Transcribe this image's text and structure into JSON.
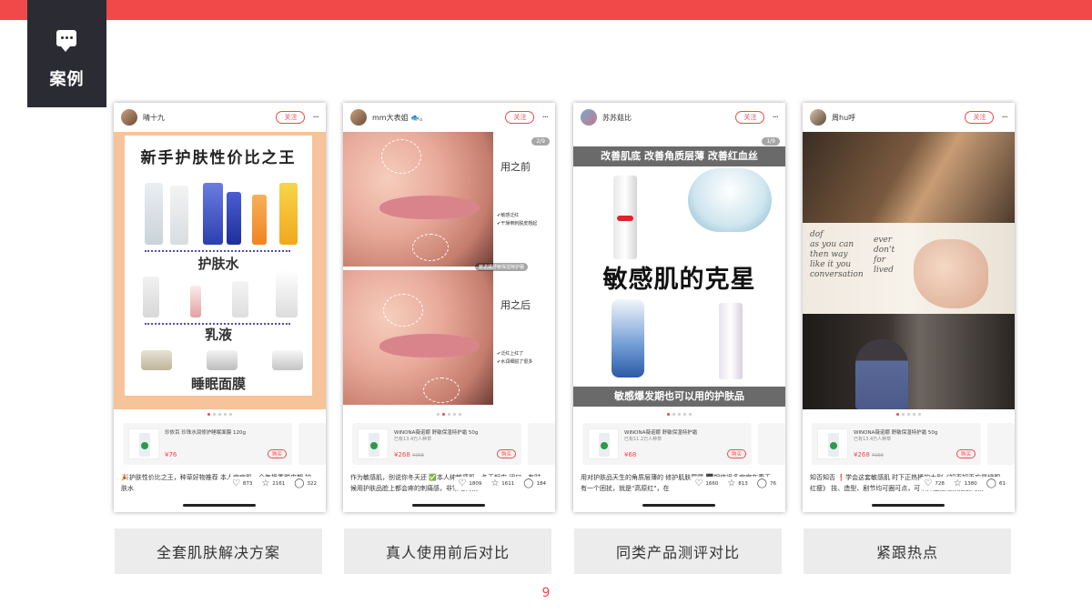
{
  "header": {
    "badge_label": "案例",
    "chat_icon": "chat-bubble-icon",
    "accent": "#f1484a",
    "badge_bg": "#2b2b33"
  },
  "page_number": "9",
  "cards": [
    {
      "user": "晴十九",
      "follow": "关注",
      "more": "···",
      "art": {
        "title": "新手护肤性价比之王",
        "sections": [
          "护肤水",
          "乳液",
          "睡眠面膜"
        ]
      },
      "product": {
        "name": "珍依百 珍珠水润修护睡眠面膜 120g",
        "sub": "",
        "price": "¥76",
        "buy": "购买"
      },
      "caption": "🎉护肤性价比之王，种草好物推荐 本人痘痘肌，全年换季脱皮期 护肤水",
      "likes": "873",
      "stars": "2161",
      "comments": "322",
      "label": "全套肌肤解决方案"
    },
    {
      "user": "mm大表姐 🐟。",
      "follow": "关注",
      "more": "···",
      "art": {
        "page": "2/9",
        "before": "用之前",
        "after": "用之后",
        "before_notes": [
          "✔敏感泛红",
          "✔干燥倒刺脱皮翘起"
        ],
        "after_notes": [
          "✔泛红上红了",
          "✔水润细腻了很多"
        ],
        "tag": "薇诺娜舒敏保湿特护霜"
      },
      "product": {
        "name": "WINONA薇诺娜 舒敏保湿特护霜 50g",
        "sub": "已有13.4万人种草",
        "price": "¥268",
        "orig": "¥268",
        "buy": "购买"
      },
      "caption": "作为敏感肌，别说你冬天还 ✅本人纯敏感肌，冬天起皮 闭口，有时候用护肤品脸上都会疼的刺痛感，非常难伺候",
      "likes": "1809",
      "stars": "1611",
      "comments": "184",
      "label": "真人使用前后对比"
    },
    {
      "user": "苏苏菇比",
      "follow": "关注",
      "more": "···",
      "art": {
        "page": "1/9",
        "top_band": "改善肌底 改善角质层薄 改善红血丝",
        "headline": "敏感肌的克星",
        "bottom_band": "敏感爆发期也可以用的护肤品"
      },
      "product": {
        "name": "WINONA薇诺娜 舒敏保湿特护霜",
        "sub": "已有11.2万人种草",
        "price": "¥68",
        "buy": "购买"
      },
      "caption": "用对护肤品天生的角质层薄的 修护肌肤屏障 ⬛相信很多宝宝在春天有一个困扰，就是\"高原红\"，在",
      "likes": "1660",
      "stars": "813",
      "comments": "76",
      "label": "同类产品测评对比"
    },
    {
      "user": "周hu呼",
      "follow": "关注",
      "more": "···",
      "art": {
        "book_lines": [
          "dof",
          "as you can",
          "then way",
          "like it you",
          "conversation",
          "ever",
          "don't",
          "for",
          "lived"
        ]
      },
      "product": {
        "name": "WINONA薇诺娜 舒敏保湿特护霜 50g",
        "sub": "已有13.4万人种草",
        "price": "¥268",
        "orig": "¥268",
        "buy": "购买"
      },
      "caption": "知否知否 ❗学会这套敏感肌 时下正热播的大剧《知否知否应是绿肥红瘦》 技、造型、剧节均可圈可点，可以算是最近热播剧的第一",
      "likes": "728",
      "stars": "1380",
      "comments": "61",
      "label": "紧跟热点"
    }
  ],
  "icons": {
    "like": "heart-icon",
    "star": "star-icon",
    "comment": "comment-icon",
    "more": "more-icon"
  }
}
